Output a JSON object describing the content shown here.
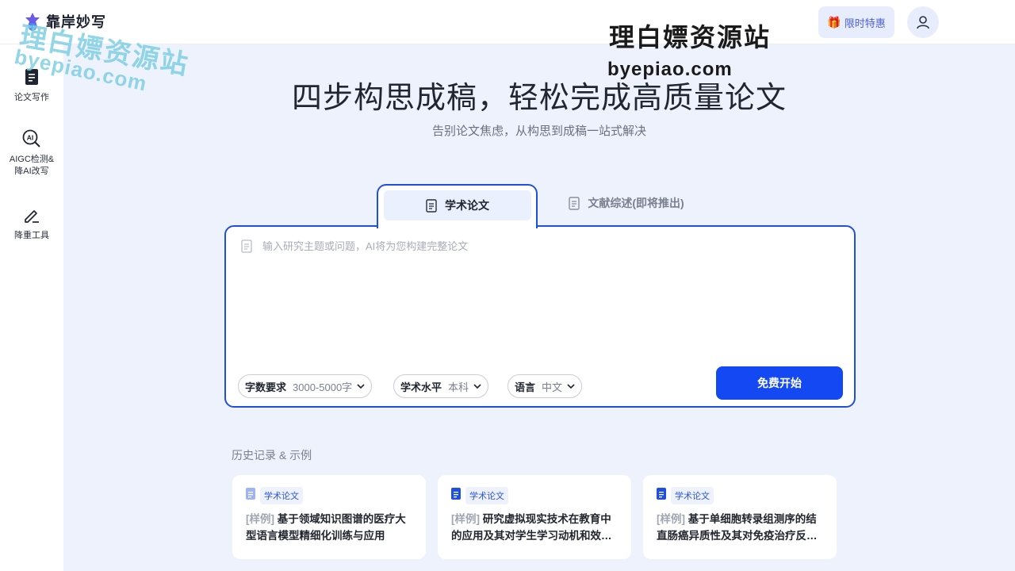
{
  "header": {
    "brand": "靠岸妙写",
    "promo_icon": "gift-icon",
    "promo_label": "限时特惠",
    "avatar_icon": "user-icon"
  },
  "sidebar": {
    "items": [
      {
        "icon": "document-icon",
        "label": "论文写作"
      },
      {
        "icon": "ai-search-icon",
        "label": "AIGC检测&\n降AI改写"
      },
      {
        "icon": "pen-icon",
        "label": "降重工具"
      }
    ]
  },
  "hero": {
    "title": "四步构思成稿，轻松完成高质量论文",
    "subtitle": "告别论文焦虑，从构思到成稿一站式解决"
  },
  "tabs": [
    {
      "label": "学术论文",
      "active": true
    },
    {
      "label": "文献综述(即将推出)",
      "active": false
    }
  ],
  "input": {
    "placeholder": "输入研究主题或问题，AI将为您构建完整论文",
    "value": ""
  },
  "options": [
    {
      "label": "字数要求",
      "value": "3000-5000字"
    },
    {
      "label": "学术水平",
      "value": "本科"
    },
    {
      "label": "语言",
      "value": "中文"
    }
  ],
  "start_button": "免费开始",
  "history": {
    "heading": "历史记录 & 示例",
    "cards": [
      {
        "tag": "学术论文",
        "prefix": "[样例]",
        "title": "基于领域知识图谱的医疗大型语言模型精细化训练与应用"
      },
      {
        "tag": "学术论文",
        "prefix": "[样例]",
        "title": "研究虚拟现实技术在教育中的应用及其对学生学习动机和效…"
      },
      {
        "tag": "学术论文",
        "prefix": "[样例]",
        "title": "基于单细胞转录组测序的结直肠癌异质性及其对免疫治疗反…"
      }
    ]
  },
  "watermarks": {
    "left_cn": "理白嫖资源站",
    "left_en": "byepiao.com",
    "right_cn": "理白嫖资源站",
    "right_en": "byepiao.com"
  },
  "colors": {
    "accent": "#1448f2",
    "page_bg": "#eef2fd",
    "tab_border": "#1f4fe0"
  }
}
